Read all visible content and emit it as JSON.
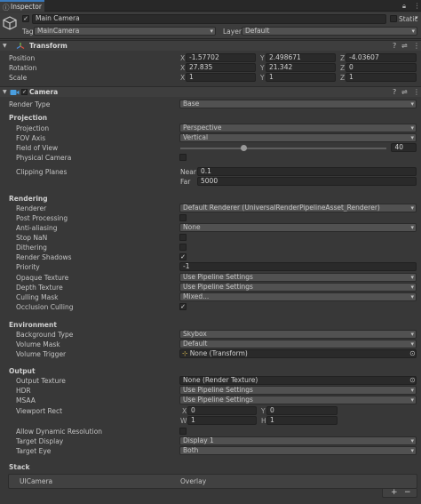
{
  "tab": {
    "title": "Inspector"
  },
  "header": {
    "object_name": "Main Camera",
    "static_label": "Static",
    "tag_label": "Tag",
    "tag_value": "MainCamera",
    "layer_label": "Layer",
    "layer_value": "Default"
  },
  "transform": {
    "title": "Transform",
    "position_label": "Position",
    "rotation_label": "Rotation",
    "scale_label": "Scale",
    "position": {
      "x": "-1.57702",
      "y": "2.498671",
      "z": "-4.03607"
    },
    "rotation": {
      "x": "27.835",
      "y": "21.342",
      "z": "0"
    },
    "scale": {
      "x": "1",
      "y": "1",
      "z": "1"
    },
    "axis_x": "X",
    "axis_y": "Y",
    "axis_z": "Z"
  },
  "camera": {
    "title": "Camera",
    "render_type_label": "Render Type",
    "render_type": "Base",
    "projection": {
      "title": "Projection",
      "projection_label": "Projection",
      "projection_value": "Perspective",
      "fov_axis_label": "FOV Axis",
      "fov_axis_value": "Vertical",
      "fov_label": "Field of View",
      "fov_value": "40",
      "fov_fraction": 0.31,
      "physical_label": "Physical Camera",
      "clipping_label": "Clipping Planes",
      "near_label": "Near",
      "near_value": "0.1",
      "far_label": "Far",
      "far_value": "5000"
    },
    "rendering": {
      "title": "Rendering",
      "renderer_label": "Renderer",
      "renderer_value": "Default Renderer (UniversalRenderPipelineAsset_Renderer)",
      "post_label": "Post Processing",
      "aa_label": "Anti-aliasing",
      "aa_value": "None",
      "stopnan_label": "Stop NaN",
      "dither_label": "Dithering",
      "shadows_label": "Render Shadows",
      "priority_label": "Priority",
      "priority_value": "-1",
      "opaque_label": "Opaque Texture",
      "opaque_value": "Use Pipeline Settings",
      "depth_label": "Depth Texture",
      "depth_value": "Use Pipeline Settings",
      "culling_label": "Culling Mask",
      "culling_value": "Mixed...",
      "occlusion_label": "Occlusion Culling"
    },
    "environment": {
      "title": "Environment",
      "bg_label": "Background Type",
      "bg_value": "Skybox",
      "vmask_label": "Volume Mask",
      "vmask_value": "Default",
      "vtrigger_label": "Volume Trigger",
      "vtrigger_value": "None (Transform)"
    },
    "output": {
      "title": "Output",
      "texture_label": "Output Texture",
      "texture_value": "None (Render Texture)",
      "hdr_label": "HDR",
      "hdr_value": "Use Pipeline Settings",
      "msaa_label": "MSAA",
      "msaa_value": "Use Pipeline Settings",
      "viewport_label": "Viewport Rect",
      "vp_x": "0",
      "vp_y": "0",
      "vp_w": "1",
      "vp_h": "1",
      "vp_x_label": "X",
      "vp_y_label": "Y",
      "vp_w_label": "W",
      "vp_h_label": "H",
      "dynres_label": "Allow Dynamic Resolution",
      "display_label": "Target Display",
      "display_value": "Display 1",
      "eye_label": "Target Eye",
      "eye_value": "Both"
    },
    "stack": {
      "title": "Stack",
      "item_name": "UICamera",
      "item_type": "Overlay",
      "add_label": "+",
      "remove_label": "−"
    }
  },
  "icons": {
    "check": "✓",
    "more": "⋮",
    "help": "?",
    "settings": "⇌"
  },
  "colors": {
    "panel": "#383838",
    "field": "#2a2a2a",
    "dropdown": "#515151",
    "accent_camera": "#4a9fe0"
  }
}
